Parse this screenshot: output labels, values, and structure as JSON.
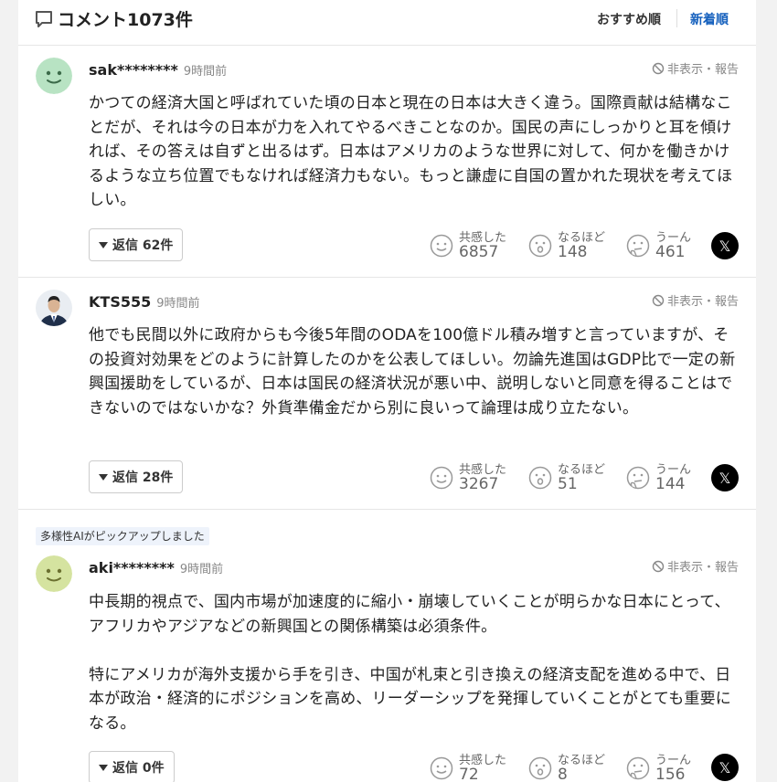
{
  "header": {
    "title": "コメント1073件",
    "sort_recommended": "おすすめ順",
    "sort_newest": "新着順"
  },
  "comments": [
    {
      "pickup": "",
      "user": "sak********",
      "time": "9時間前",
      "hide": "非表示・報告",
      "text": "かつての経済大国と呼ばれていた頃の日本と現在の日本は大きく違う。国際貢献は結構なことだが、それは今の日本が力を入れてやるべきことなのか。国民の声にしっかりと耳を傾ければ、その答えは自ずと出るはず。日本はアメリカのような世界に対して、何かを働きかけるような立ち位置でもなければ経済力もない。もっと謙虚に自国の置かれた現状を考えてほしい。",
      "replies": "返信 62件",
      "reactions": {
        "empathy_label": "共感した",
        "empathy": "6857",
        "naruhodo_label": "なるほど",
        "naruhodo": "148",
        "uun_label": "うーん",
        "uun": "461"
      },
      "share": "𝕏"
    },
    {
      "pickup": "",
      "user": "KTS555",
      "time": "9時間前",
      "hide": "非表示・報告",
      "text": "他でも民間以外に政府からも今後5年間のODAを100億ドル積み増すと言っていますが、その投資対効果をどのように計算したのかを公表してほしい。勿論先進国はGDP比で一定の新興国援助をしているが、日本は国民の経済状況が悪い中、説明しないと同意を得ることはできないのではないかな？外貨準備金だから別に良いって論理は成り立たない。",
      "replies": "返信 28件",
      "reactions": {
        "empathy_label": "共感した",
        "empathy": "3267",
        "naruhodo_label": "なるほど",
        "naruhodo": "51",
        "uun_label": "うーん",
        "uun": "144"
      },
      "share": "𝕏"
    },
    {
      "pickup": "多様性AIがピックアップしました",
      "user": "aki********",
      "time": "9時間前",
      "hide": "非表示・報告",
      "text": "中長期的視点で、国内市場が加速度的に縮小・崩壊していくことが明らかな日本にとって、アフリカやアジアなどの新興国との関係構築は必須条件。\n\n特にアメリカが海外支援から手を引き、中国が札束と引き換えの経済支配を進める中で、日本が政治・経済的にポジションを高め、リーダーシップを発揮していくことがとても重要になる。",
      "replies": "返信 0件",
      "reactions": {
        "empathy_label": "共感した",
        "empathy": "72",
        "naruhodo_label": "なるほど",
        "naruhodo": "8",
        "uun_label": "うーん",
        "uun": "156"
      },
      "share": "𝕏"
    }
  ],
  "colors": {
    "accent": "#1560bd",
    "avatar_green": "#b8e3c3",
    "avatar_yellowgreen": "#d5e3a0"
  }
}
